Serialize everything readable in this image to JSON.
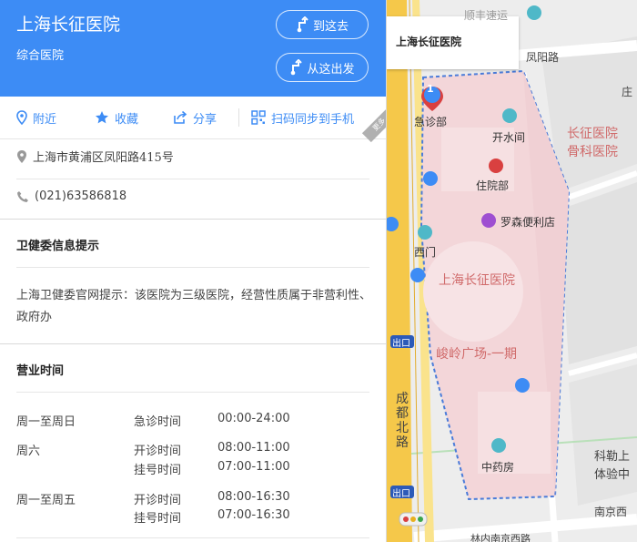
{
  "place": {
    "name": "上海长征医院",
    "category": "综合医院",
    "address": "上海市黄浦区凤阳路415号",
    "phone": "(021)63586818"
  },
  "header_buttons": {
    "goto": "到这去",
    "from_here": "从这出发"
  },
  "actions": {
    "nearby": "附近",
    "favorite": "收藏",
    "share": "分享",
    "scan": "扫码同步到手机",
    "more_tag": "更多"
  },
  "notice": {
    "title": "卫健委信息提示",
    "text": "上海卫健委官网提示：该医院为三级医院，经营性质属于非营利性、政府办"
  },
  "hours": {
    "title": "营业时间",
    "rows": [
      {
        "days": "周一至周日",
        "entries": [
          {
            "label": "急诊时间",
            "time": "00:00-24:00"
          }
        ]
      },
      {
        "days": "周六",
        "entries": [
          {
            "label": "开诊时间",
            "time": "08:00-11:00"
          },
          {
            "label": "挂号时间",
            "time": "07:00-11:00"
          }
        ]
      },
      {
        "days": "周一至周五",
        "entries": [
          {
            "label": "开诊时间",
            "time": "08:00-16:30"
          },
          {
            "label": "挂号时间",
            "time": "07:00-16:30"
          }
        ]
      }
    ]
  },
  "map": {
    "card_title": "上海长征医院",
    "marker_number": "1",
    "labels": {
      "emergency": "急诊部",
      "water": "开水间",
      "inpatient": "住院部",
      "store": "罗森便利店",
      "west_gate": "西门",
      "hospital": "上海长征医院",
      "ortho_1": "长征医院",
      "ortho_2": "骨科医院",
      "plaza": "峻岭广场-一期",
      "pharmacy": "中药房",
      "exit1": "出口",
      "exit2": "出口",
      "exit3": "出口",
      "road_fengyang": "凤阳路",
      "road_chengdu": "成都北路",
      "road_nanjing_w": "南京西",
      "road_nanjing_e": "林内南京西路",
      "top_road": "顺丰速运",
      "zhuang": "庄",
      "kexue_1": "科勒上",
      "kexue_2": "体验中"
    },
    "colors": {
      "campus": "#f3d6d9",
      "boundary": "#4a7bd9",
      "highway": "#f5c84a",
      "pin": "#d94040"
    }
  }
}
